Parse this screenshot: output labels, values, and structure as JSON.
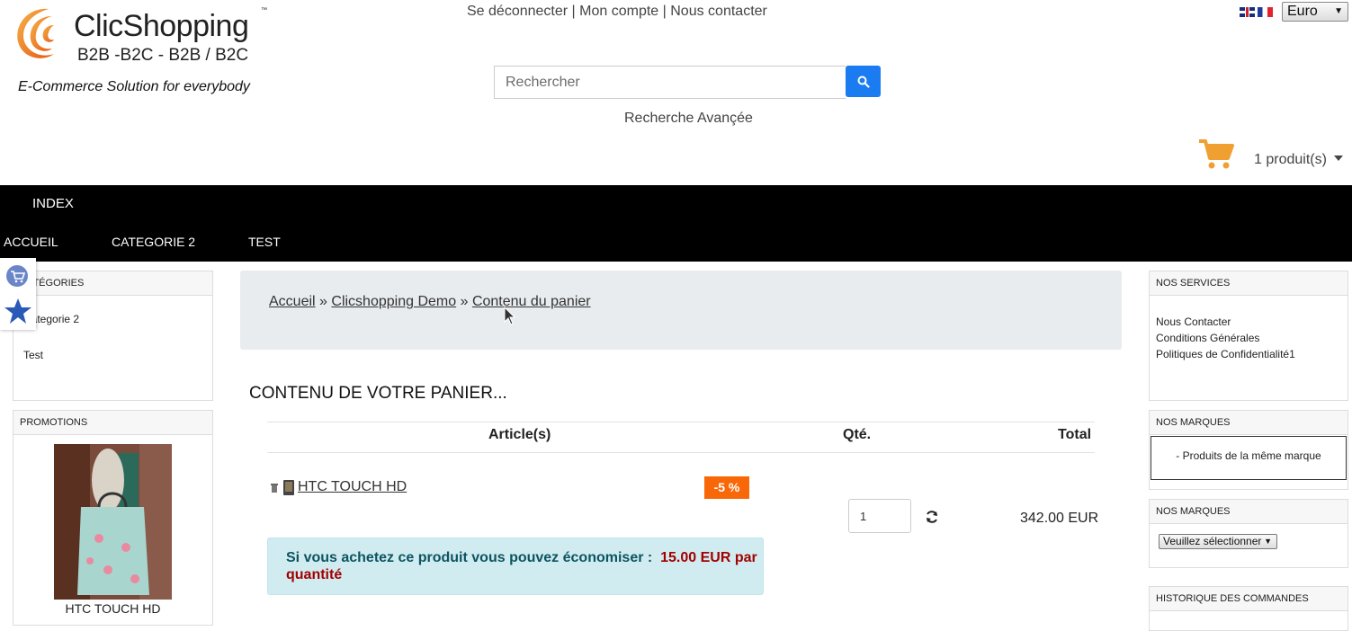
{
  "header": {
    "brand": "ClicShopping",
    "tm": "™",
    "tagline_models": "B2B -B2C - B2B / B2C",
    "tagline": "E-Commerce Solution for everybody",
    "toplinks": [
      "Se déconnecter",
      "Mon compte",
      "Nous contacter"
    ],
    "separator": "|",
    "currency": "Euro",
    "search_placeholder": "Rechercher",
    "advanced_search": "Recherche Avançée",
    "cart_text": "1 produit(s)"
  },
  "nav": {
    "items": [
      "INDEX",
      "ACCUEIL",
      "CATEGORIE 2",
      "TEST"
    ]
  },
  "left": {
    "categories": {
      "title": "CATÉGORIES",
      "items": [
        "Categorie 2",
        "Test"
      ]
    },
    "promotions": {
      "title": "PROMOTIONS",
      "product": "HTC TOUCH HD"
    }
  },
  "right": {
    "services": {
      "title": "NOS SERVICES",
      "items": [
        "Nous Contacter",
        "Conditions Générales",
        "Politiques de Confidentialité1"
      ]
    },
    "brands": {
      "title": "NOS MARQUES",
      "text": "- Produits de la même marque"
    },
    "brands2": {
      "title": "NOS MARQUES",
      "select": "Veuillez sélectionner"
    },
    "history": {
      "title": "HISTORIQUE DES COMMANDES"
    }
  },
  "breadcrumb": {
    "items": [
      "Accueil",
      "Clicshopping Demo",
      "Contenu du panier"
    ],
    "sep": "»"
  },
  "cart": {
    "title": "CONTENU DE VOTRE PANIER...",
    "col_article": "Article(s)",
    "col_qty": "Qté.",
    "col_total": "Total",
    "product_name": "HTC TOUCH HD",
    "discount": "-5 %",
    "qty": "1",
    "total": "342.00 EUR",
    "save_text": "Si vous achetez ce produit vous pouvez économiser :",
    "save_amount": "15.00 EUR par",
    "save_unit": "quantité"
  },
  "colors": {
    "accent": "#1a7cf0",
    "cart_icon": "#f0a030",
    "discount": "#f86808",
    "nav": "#000000"
  }
}
